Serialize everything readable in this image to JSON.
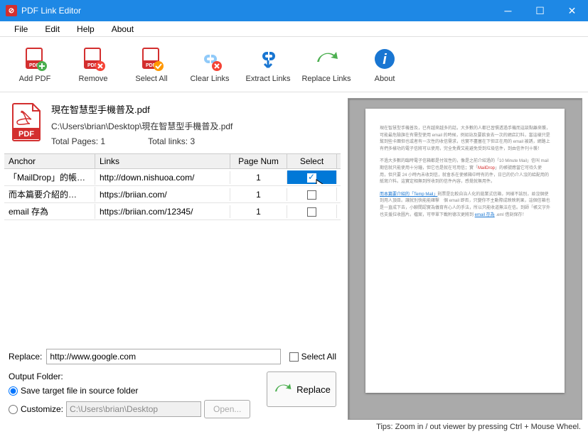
{
  "window": {
    "title": "PDF Link Editor"
  },
  "menu": {
    "file": "File",
    "edit": "Edit",
    "help": "Help",
    "about": "About"
  },
  "toolbar": {
    "add_pdf": "Add PDF",
    "remove": "Remove",
    "select_all": "Select All",
    "clear_links": "Clear Links",
    "extract_links": "Extract Links",
    "replace_links": "Replace Links",
    "about": "About"
  },
  "file": {
    "name": "現在智慧型手機普及.pdf",
    "path": "C:\\Users\\brian\\Desktop\\現在智慧型手機普及.pdf",
    "total_pages_label": "Total Pages:",
    "total_pages": "1",
    "total_links_label": "Total links:",
    "total_links": "3"
  },
  "table": {
    "headers": {
      "anchor": "Anchor",
      "links": "Links",
      "page": "Page Num",
      "select": "Select"
    },
    "rows": [
      {
        "anchor": "「MailDrop」的帳…",
        "link": "http://down.nishuoa.com/",
        "page": "1",
        "selected": true
      },
      {
        "anchor": "而本篇要介紹的…",
        "link": "https://briian.com/",
        "page": "1",
        "selected": false
      },
      {
        "anchor": "email 存為",
        "link": "https://briian.com/12345/",
        "page": "1",
        "selected": false
      }
    ]
  },
  "replace": {
    "label": "Replace:",
    "value": "http://www.google.com",
    "select_all": "Select All"
  },
  "output": {
    "heading": "Output Folder:",
    "save_source": "Save target file in source folder",
    "customize": "Customize:",
    "custom_path": "C:\\Users\\brian\\Desktop",
    "open_btn": "Open...",
    "replace_btn": "Replace"
  },
  "tips": "Tips: Zoom in / out viewer by pressing Ctrl + Mouse Wheel."
}
